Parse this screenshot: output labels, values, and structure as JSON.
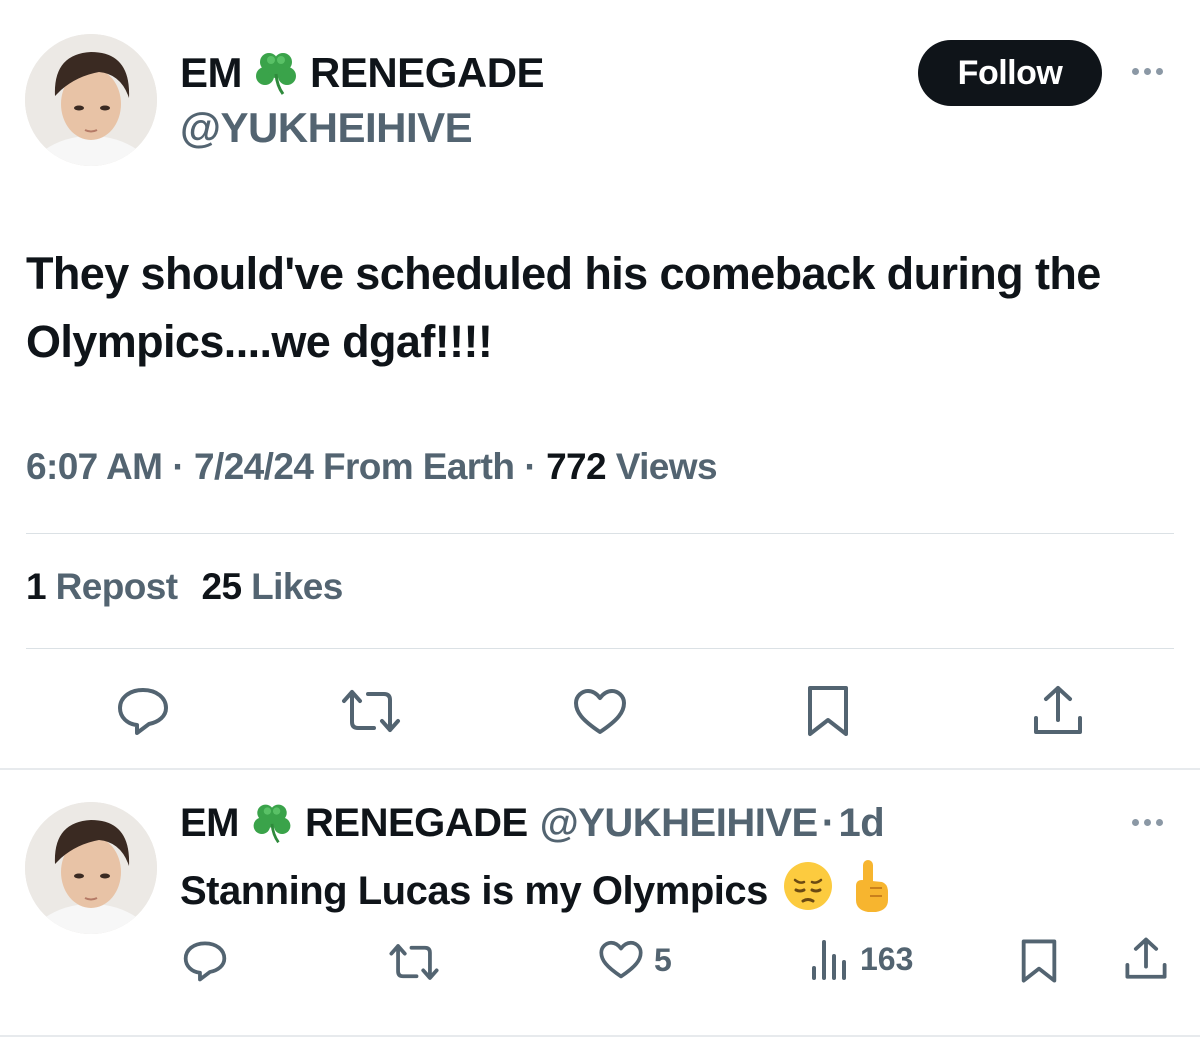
{
  "tweet": {
    "author": {
      "display_name_part1": "EM",
      "display_name_part2": "RENEGADE",
      "display_name_emoji": "clover-icon",
      "handle": "@YUKHEIHIVE"
    },
    "follow_label": "Follow",
    "text": "They should've scheduled his comeback during the Olympics....we dgaf!!!!",
    "meta": {
      "time": "6:07 AM",
      "sep1": "·",
      "date_source": "7/24/24 From Earth",
      "sep2": "·",
      "views_count": "772",
      "views_label": "Views"
    },
    "stats": {
      "reposts_count": "1",
      "reposts_label": "Repost",
      "likes_count": "25",
      "likes_label": "Likes"
    },
    "actions": [
      "reply-icon",
      "repost-icon",
      "like-icon",
      "bookmark-icon",
      "share-icon"
    ]
  },
  "reply": {
    "author": {
      "display_name_part1": "EM",
      "display_name_part2": "RENEGADE",
      "handle": "@YUKHEIHIVE",
      "sep": "·",
      "age": "1d"
    },
    "text": "Stanning Lucas is my Olympics",
    "emojis": [
      "pensive-face-emoji",
      "pointing-up-emoji"
    ],
    "likes_count": "5",
    "views_count": "163"
  },
  "colors": {
    "text_primary": "#0f1419",
    "text_secondary": "#536471",
    "follow_bg": "#0f1419",
    "divider": "#dbe1e5",
    "clover": "#3aa34a"
  }
}
